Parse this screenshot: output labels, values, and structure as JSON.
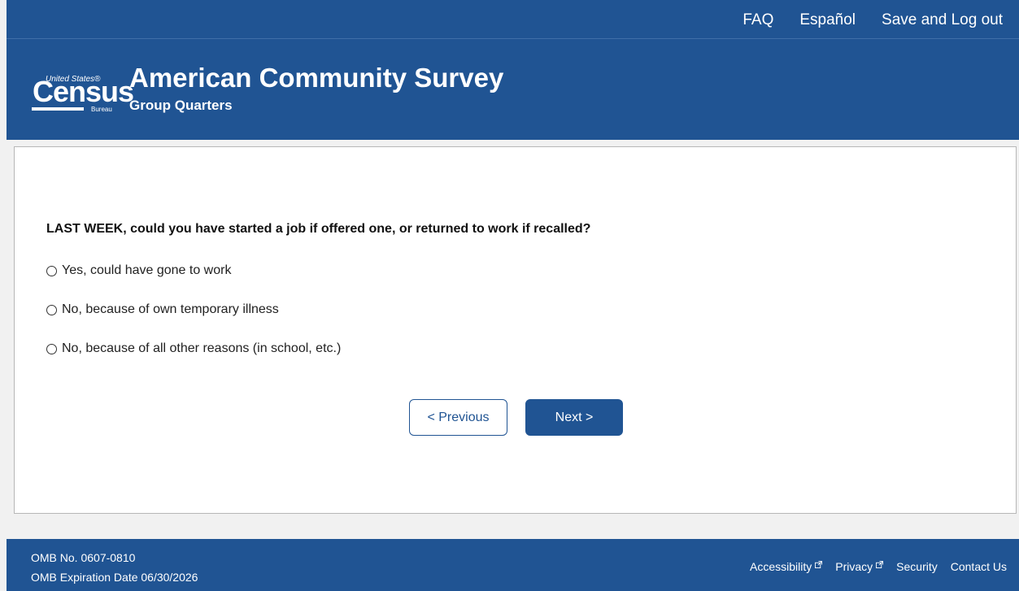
{
  "top_nav": {
    "faq": "FAQ",
    "espanol": "Español",
    "save_logout": "Save and Log out"
  },
  "header": {
    "logo": {
      "small_text": "United States®",
      "main_text": "Census",
      "bureau_text": "Bureau"
    },
    "title": "American Community Survey",
    "subtitle": "Group Quarters"
  },
  "main": {
    "question": "LAST WEEK, could you have started a job if offered one, or returned to work if recalled?",
    "options": [
      "Yes, could have gone to work",
      "No, because of own temporary illness",
      "No, because of all other reasons (in school, etc.)"
    ],
    "buttons": {
      "previous": "< Previous",
      "next": "Next >"
    }
  },
  "footer": {
    "omb_number": "OMB No. 0607-0810",
    "omb_expiration": "OMB Expiration Date 06/30/2026",
    "links": {
      "accessibility": "Accessibility",
      "privacy": "Privacy",
      "security": "Security",
      "contact": "Contact Us"
    }
  },
  "colors": {
    "brand_blue": "#205493",
    "background": "#f1f1f1",
    "card_border": "#b7b7b7"
  },
  "icons": {
    "external_link": "external-link-icon",
    "radio": "radio-empty-icon"
  }
}
